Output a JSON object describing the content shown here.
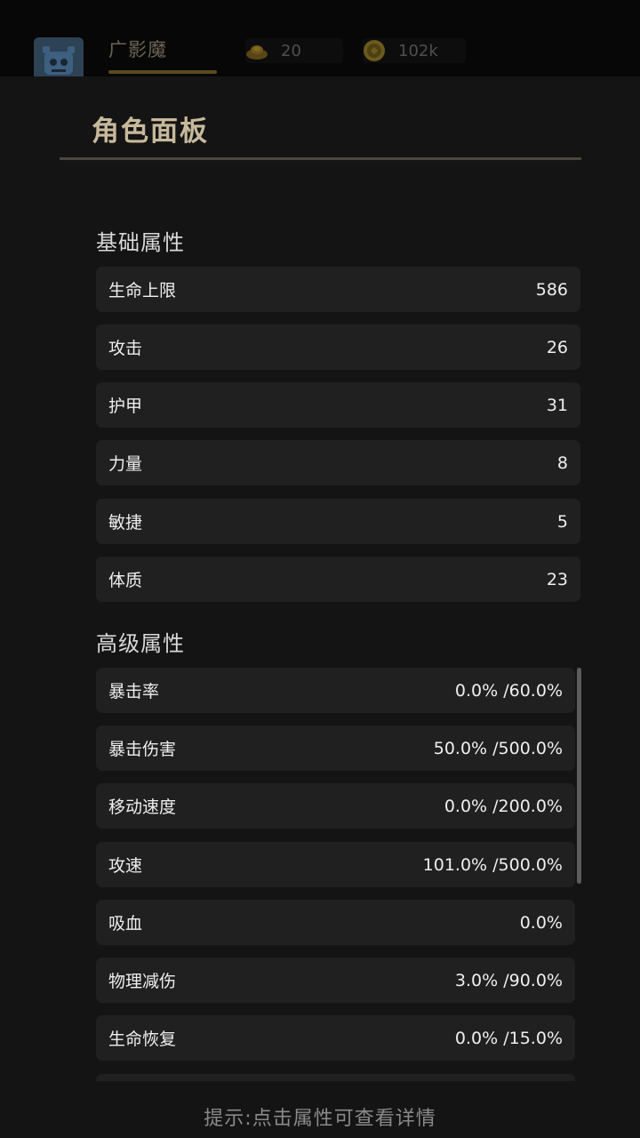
{
  "header": {
    "character_tab": "广影魔",
    "resources": [
      {
        "icon": "gold-ingot-icon",
        "value": "20"
      },
      {
        "icon": "coin-icon",
        "value": "102k"
      }
    ]
  },
  "panel": {
    "title": "角色面板",
    "basic": {
      "title": "基础属性",
      "rows": [
        {
          "label": "生命上限",
          "value": "586"
        },
        {
          "label": "攻击",
          "value": "26"
        },
        {
          "label": "护甲",
          "value": "31"
        },
        {
          "label": "力量",
          "value": "8"
        },
        {
          "label": "敏捷",
          "value": "5"
        },
        {
          "label": "体质",
          "value": "23"
        }
      ]
    },
    "advanced": {
      "title": "高级属性",
      "rows": [
        {
          "label": "暴击率",
          "value": "0.0% /60.0%"
        },
        {
          "label": "暴击伤害",
          "value": "50.0% /500.0%"
        },
        {
          "label": "移动速度",
          "value": "0.0% /200.0%"
        },
        {
          "label": "攻速",
          "value": "101.0% /500.0%"
        },
        {
          "label": "吸血",
          "value": "0.0%"
        },
        {
          "label": "物理减伤",
          "value": "3.0% /90.0%"
        },
        {
          "label": "生命恢复",
          "value": "0.0% /15.0%"
        },
        {
          "label": "",
          "value": ""
        }
      ]
    },
    "hint": "提示:点击属性可查看详情"
  },
  "colors": {
    "title_gold": "#c7b99b",
    "row_bg": "#202020",
    "panel_bg": "#141414"
  }
}
